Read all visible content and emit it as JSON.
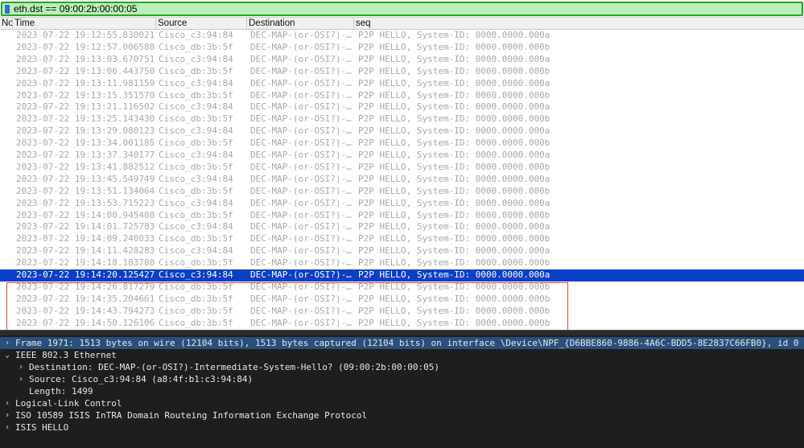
{
  "filter": {
    "text": "eth.dst == 09:00:2b:00:00:05"
  },
  "columns": {
    "no": "No",
    "time": "Time",
    "source": "Source",
    "destination": "Destination",
    "info": "seq"
  },
  "packets": [
    {
      "time": "2023-07-22 19:12:55.830021",
      "source": "Cisco_c3:94:84",
      "destination": "DEC-MAP-(or-OSI?)-…",
      "info": "P2P HELLO, System-ID: 0000.0000.000a"
    },
    {
      "time": "2023-07-22 19:12:57.006588",
      "source": "Cisco_db:3b:5f",
      "destination": "DEC-MAP-(or-OSI?)-…",
      "info": "P2P HELLO, System-ID: 0000.0000.000b"
    },
    {
      "time": "2023-07-22 19:13:03.670751",
      "source": "Cisco_c3:94:84",
      "destination": "DEC-MAP-(or-OSI?)-…",
      "info": "P2P HELLO, System-ID: 0000.0000.000a"
    },
    {
      "time": "2023-07-22 19:13:06.443750",
      "source": "Cisco_db:3b:5f",
      "destination": "DEC-MAP-(or-OSI?)-…",
      "info": "P2P HELLO, System-ID: 0000.0000.000b"
    },
    {
      "time": "2023-07-22 19:13:11.981159",
      "source": "Cisco_c3:94:84",
      "destination": "DEC-MAP-(or-OSI?)-…",
      "info": "P2P HELLO, System-ID: 0000.0000.000a"
    },
    {
      "time": "2023-07-22 19:13:15.351570",
      "source": "Cisco_db:3b:5f",
      "destination": "DEC-MAP-(or-OSI?)-…",
      "info": "P2P HELLO, System-ID: 0000.0000.000b"
    },
    {
      "time": "2023-07-22 19:13:21.116502",
      "source": "Cisco_c3:94:84",
      "destination": "DEC-MAP-(or-OSI?)-…",
      "info": "P2P HELLO, System-ID: 0000.0000.000a"
    },
    {
      "time": "2023-07-22 19:13:25.143430",
      "source": "Cisco_db:3b:5f",
      "destination": "DEC-MAP-(or-OSI?)-…",
      "info": "P2P HELLO, System-ID: 0000.0000.000b"
    },
    {
      "time": "2023-07-22 19:13:29.080123",
      "source": "Cisco_c3:94:84",
      "destination": "DEC-MAP-(or-OSI?)-…",
      "info": "P2P HELLO, System-ID: 0000.0000.000a"
    },
    {
      "time": "2023-07-22 19:13:34.001185",
      "source": "Cisco_db:3b:5f",
      "destination": "DEC-MAP-(or-OSI?)-…",
      "info": "P2P HELLO, System-ID: 0000.0000.000b"
    },
    {
      "time": "2023-07-22 19:13:37.340177",
      "source": "Cisco_c3:94:84",
      "destination": "DEC-MAP-(or-OSI?)-…",
      "info": "P2P HELLO, System-ID: 0000.0000.000a"
    },
    {
      "time": "2023-07-22 19:13:41.882512",
      "source": "Cisco_db:3b:5f",
      "destination": "DEC-MAP-(or-OSI?)-…",
      "info": "P2P HELLO, System-ID: 0000.0000.000b"
    },
    {
      "time": "2023-07-22 19:13:45.549749",
      "source": "Cisco_c3:94:84",
      "destination": "DEC-MAP-(or-OSI?)-…",
      "info": "P2P HELLO, System-ID: 0000.0000.000a"
    },
    {
      "time": "2023-07-22 19:13:51.134064",
      "source": "Cisco_db:3b:5f",
      "destination": "DEC-MAP-(or-OSI?)-…",
      "info": "P2P HELLO, System-ID: 0000.0000.000b"
    },
    {
      "time": "2023-07-22 19:13:53.715223",
      "source": "Cisco_c3:94:84",
      "destination": "DEC-MAP-(or-OSI?)-…",
      "info": "P2P HELLO, System-ID: 0000.0000.000a"
    },
    {
      "time": "2023-07-22 19:14:00.945408",
      "source": "Cisco_db:3b:5f",
      "destination": "DEC-MAP-(or-OSI?)-…",
      "info": "P2P HELLO, System-ID: 0000.0000.000b"
    },
    {
      "time": "2023-07-22 19:14:01.725783",
      "source": "Cisco_c3:94:84",
      "destination": "DEC-MAP-(or-OSI?)-…",
      "info": "P2P HELLO, System-ID: 0000.0000.000a"
    },
    {
      "time": "2023-07-22 19:14:09.240033",
      "source": "Cisco_db:3b:5f",
      "destination": "DEC-MAP-(or-OSI?)-…",
      "info": "P2P HELLO, System-ID: 0000.0000.000b"
    },
    {
      "time": "2023-07-22 19:14:11.428283",
      "source": "Cisco_c3:94:84",
      "destination": "DEC-MAP-(or-OSI?)-…",
      "info": "P2P HELLO, System-ID: 0000.0000.000a"
    },
    {
      "time": "2023-07-22 19:14:18.183708",
      "source": "Cisco_db:3b:5f",
      "destination": "DEC-MAP-(or-OSI?)-…",
      "info": "P2P HELLO, System-ID: 0000.0000.000b"
    },
    {
      "time": "2023-07-22 19:14:20.125427",
      "source": "Cisco_c3:94:84",
      "destination": "DEC-MAP-(or-OSI?)-…",
      "info": "P2P HELLO, System-ID: 0000.0000.000a",
      "selected": true
    },
    {
      "time": "2023-07-22 19:14:26.817279",
      "source": "Cisco_db:3b:5f",
      "destination": "DEC-MAP-(or-OSI?)-…",
      "info": "P2P HELLO, System-ID: 0000.0000.000b"
    },
    {
      "time": "2023-07-22 19:14:35.204661",
      "source": "Cisco_db:3b:5f",
      "destination": "DEC-MAP-(or-OSI?)-…",
      "info": "P2P HELLO, System-ID: 0000.0000.000b"
    },
    {
      "time": "2023-07-22 19:14:43.794273",
      "source": "Cisco_db:3b:5f",
      "destination": "DEC-MAP-(or-OSI?)-…",
      "info": "P2P HELLO, System-ID: 0000.0000.000b"
    },
    {
      "time": "2023-07-22 19:14:50.126106",
      "source": "Cisco_db:3b:5f",
      "destination": "DEC-MAP-(or-OSI?)-…",
      "info": "P2P HELLO, System-ID: 0000.0000.000b"
    }
  ],
  "details": [
    {
      "indent": 0,
      "arrow": "›",
      "text": "Frame 1971: 1513 bytes on wire (12104 bits), 1513 bytes captured (12104 bits) on interface \\Device\\NPF_{D6BBE860-9886-4A6C-BDD5-8E2837C66FB0}, id 0",
      "selected": true
    },
    {
      "indent": 0,
      "arrow": "⌄",
      "text": "IEEE 802.3 Ethernet"
    },
    {
      "indent": 1,
      "arrow": "›",
      "text": "Destination: DEC-MAP-(or-OSI?)-Intermediate-System-Hello? (09:00:2b:00:00:05)"
    },
    {
      "indent": 1,
      "arrow": "›",
      "text": "Source: Cisco_c3:94:84 (a8:4f:b1:c3:94:84)"
    },
    {
      "indent": 1,
      "arrow": "",
      "text": "Length: 1499"
    },
    {
      "indent": 0,
      "arrow": "›",
      "text": "Logical-Link Control"
    },
    {
      "indent": 0,
      "arrow": "›",
      "text": "ISO 10589 ISIS InTRA Domain Routeing Information Exchange Protocol"
    },
    {
      "indent": 0,
      "arrow": "›",
      "text": "ISIS HELLO"
    }
  ],
  "colors": {
    "filter_valid_bg": "#b8f0b8",
    "selected_row_bg": "#0a3fc7",
    "highlight_box": "#e0453a"
  }
}
